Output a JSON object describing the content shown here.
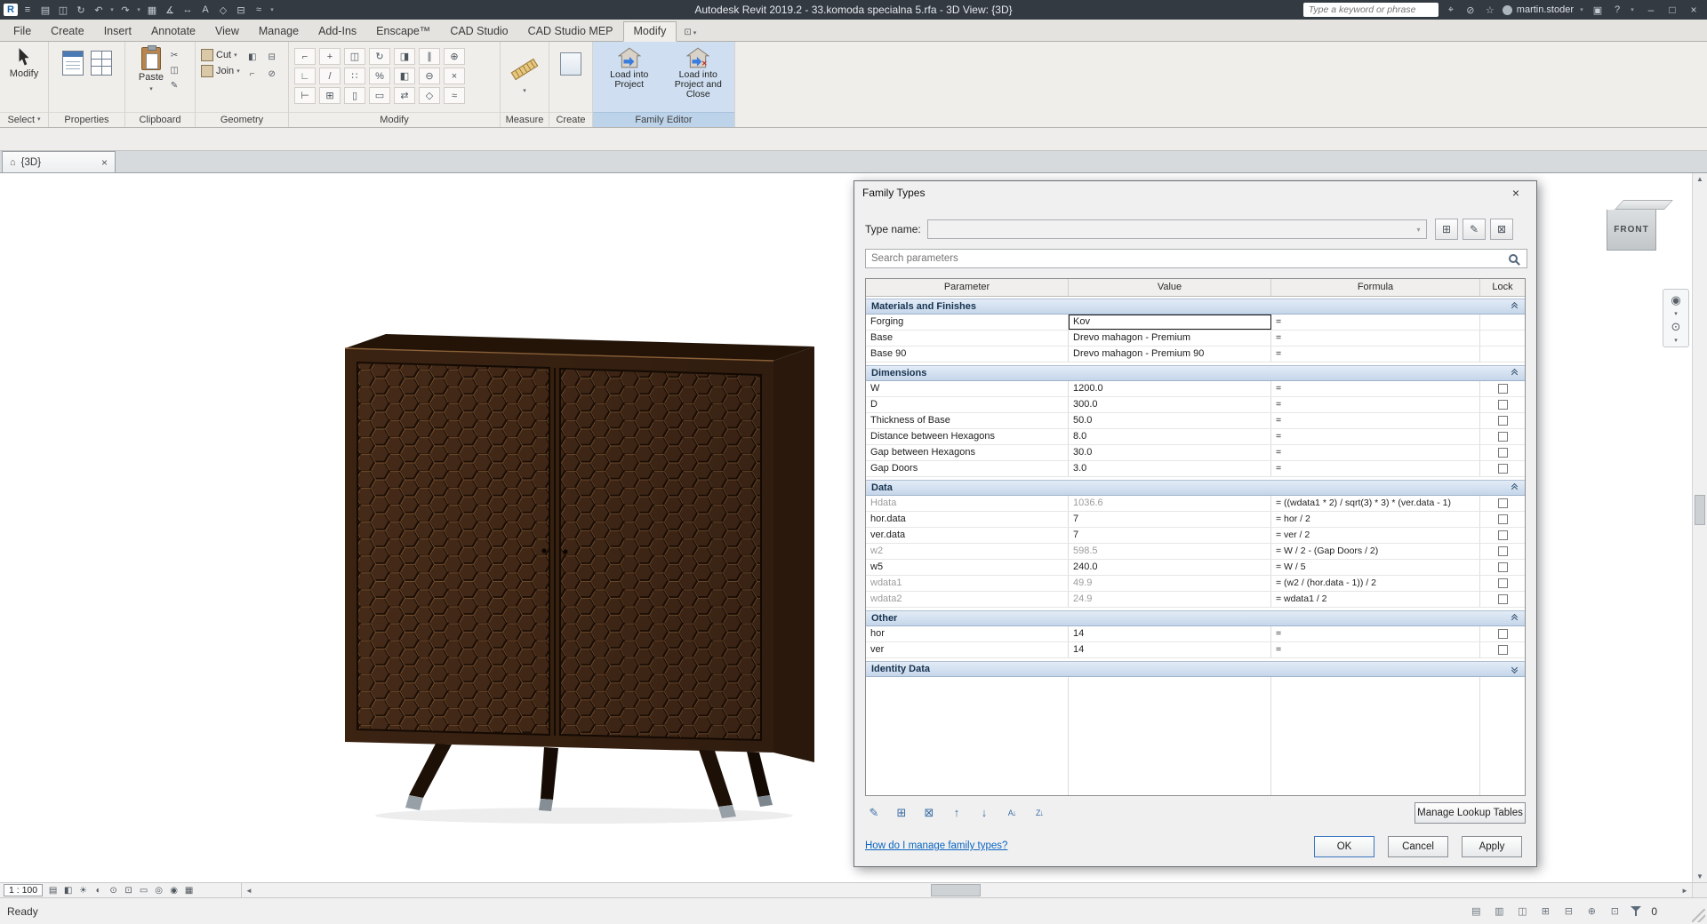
{
  "titlebar": {
    "app_title": "Autodesk Revit 2019.2 - 33.komoda specialna 5.rfa - 3D View: {3D}",
    "search_placeholder": "Type a keyword or phrase",
    "username": "martin.stoder"
  },
  "glyphs": {
    "caret": "▾",
    "close": "×",
    "house": "⌂",
    "up": "▲",
    "down": "▼",
    "left": "◄",
    "right": "►"
  },
  "ribbon": {
    "tabs": [
      {
        "label": "File",
        "active": false
      },
      {
        "label": "Create",
        "active": false
      },
      {
        "label": "Insert",
        "active": false
      },
      {
        "label": "Annotate",
        "active": false
      },
      {
        "label": "View",
        "active": false
      },
      {
        "label": "Manage",
        "active": false
      },
      {
        "label": "Add-Ins",
        "active": false
      },
      {
        "label": "Enscape™",
        "active": false
      },
      {
        "label": "CAD Studio",
        "active": false
      },
      {
        "label": "CAD Studio MEP",
        "active": false
      },
      {
        "label": "Modify",
        "active": true
      }
    ],
    "panels": {
      "select": {
        "label": "Select",
        "modify_button": "Modify"
      },
      "properties": {
        "label": "Properties"
      },
      "clipboard": {
        "label": "Clipboard",
        "paste": "Paste"
      },
      "geometry": {
        "label": "Geometry",
        "cut": "Cut",
        "join": "Join"
      },
      "modify": {
        "label": "Modify"
      },
      "measure": {
        "label": "Measure"
      },
      "create": {
        "label": "Create"
      },
      "family_editor": {
        "label": "Family Editor",
        "load": "Load into Project",
        "load_close": "Load into Project and Close"
      }
    }
  },
  "view_tabs": {
    "active": "{3D}"
  },
  "viewcube": {
    "front": "FRONT"
  },
  "dialog": {
    "title": "Family Types",
    "type_name_label": "Type name:",
    "search_placeholder": "Search parameters",
    "columns": {
      "parameter": "Parameter",
      "value": "Value",
      "formula": "Formula",
      "lock": "Lock"
    },
    "sections": [
      {
        "name": "Materials and Finishes",
        "collapsed": false,
        "rows": [
          {
            "param": "Forging",
            "value": "Kov",
            "formula": "=",
            "lockable": false,
            "gray": false,
            "focused": true
          },
          {
            "param": "Base",
            "value": "Drevo mahagon - Premium",
            "formula": "=",
            "lockable": false,
            "gray": false,
            "focused": false
          },
          {
            "param": "Base 90",
            "value": "Drevo mahagon - Premium 90",
            "formula": "=",
            "lockable": false,
            "gray": false,
            "focused": false
          }
        ]
      },
      {
        "name": "Dimensions",
        "collapsed": false,
        "rows": [
          {
            "param": "W",
            "value": "1200.0",
            "formula": "=",
            "lockable": true,
            "gray": false,
            "focused": false
          },
          {
            "param": "D",
            "value": "300.0",
            "formula": "=",
            "lockable": true,
            "gray": false,
            "focused": false
          },
          {
            "param": "Thickness of Base",
            "value": "50.0",
            "formula": "=",
            "lockable": true,
            "gray": false,
            "focused": false
          },
          {
            "param": "Distance between Hexagons",
            "value": "8.0",
            "formula": "=",
            "lockable": true,
            "gray": false,
            "focused": false
          },
          {
            "param": "Gap between Hexagons",
            "value": "30.0",
            "formula": "=",
            "lockable": true,
            "gray": false,
            "focused": false
          },
          {
            "param": "Gap Doors",
            "value": "3.0",
            "formula": "=",
            "lockable": true,
            "gray": false,
            "focused": false
          }
        ]
      },
      {
        "name": "Data",
        "collapsed": false,
        "rows": [
          {
            "param": "Hdata",
            "value": "1036.6",
            "formula": "= ((wdata1 * 2) / sqrt(3) * 3) * (ver.data - 1)",
            "lockable": true,
            "gray": true,
            "focused": false
          },
          {
            "param": "hor.data",
            "value": "7",
            "formula": "= hor / 2",
            "lockable": true,
            "gray": false,
            "focused": false
          },
          {
            "param": "ver.data",
            "value": "7",
            "formula": "= ver / 2",
            "lockable": true,
            "gray": false,
            "focused": false
          },
          {
            "param": "w2",
            "value": "598.5",
            "formula": "= W / 2 - (Gap Doors / 2)",
            "lockable": true,
            "gray": true,
            "focused": false
          },
          {
            "param": "w5",
            "value": "240.0",
            "formula": "= W / 5",
            "lockable": true,
            "gray": false,
            "focused": false
          },
          {
            "param": "wdata1",
            "value": "49.9",
            "formula": "= (w2 / (hor.data - 1)) / 2",
            "lockable": true,
            "gray": true,
            "focused": false
          },
          {
            "param": "wdata2",
            "value": "24.9",
            "formula": "= wdata1 / 2",
            "lockable": true,
            "gray": true,
            "focused": false
          }
        ]
      },
      {
        "name": "Other",
        "collapsed": false,
        "rows": [
          {
            "param": "hor",
            "value": "14",
            "formula": "=",
            "lockable": true,
            "gray": false,
            "focused": false
          },
          {
            "param": "ver",
            "value": "14",
            "formula": "=",
            "lockable": true,
            "gray": false,
            "focused": false
          }
        ]
      },
      {
        "name": "Identity Data",
        "collapsed": true,
        "rows": []
      }
    ],
    "footer": {
      "manage_lookup": "Manage Lookup Tables",
      "help_link": "How do I manage family types?",
      "ok": "OK",
      "cancel": "Cancel",
      "apply": "Apply"
    }
  },
  "status": {
    "scale": "1 : 100",
    "ready": "Ready",
    "selection_count": "0"
  },
  "colors": {
    "section_header_top": "#e3ecf7",
    "section_header_bottom": "#c5d6ea",
    "family_editor_highlight": "#cfdff1",
    "titlebar": "#333a42"
  },
  "icon_strips": {
    "qat": [
      {
        "name": "revit-logo",
        "glyph": "R",
        "cls": "logo"
      },
      {
        "name": "app-menu-icon",
        "glyph": "≡"
      },
      {
        "name": "open-icon",
        "glyph": "▤"
      },
      {
        "name": "save-icon",
        "glyph": "◫"
      },
      {
        "name": "sync-icon",
        "glyph": "↻"
      },
      {
        "name": "undo-icon",
        "glyph": "↶"
      },
      {
        "name": "undo-caret-icon",
        "glyph": "▾",
        "cls": "caret"
      },
      {
        "name": "redo-icon",
        "glyph": "↷"
      },
      {
        "name": "redo-caret-icon",
        "glyph": "▾",
        "cls": "caret"
      },
      {
        "name": "print-icon",
        "glyph": "▦"
      },
      {
        "name": "measure-qat-icon",
        "glyph": "∡"
      },
      {
        "name": "aligned-dimension-icon",
        "glyph": "↔"
      },
      {
        "name": "text-note-icon",
        "glyph": "A"
      },
      {
        "name": "default-3d-view-icon",
        "glyph": "◇"
      },
      {
        "name": "section-icon",
        "glyph": "⊟"
      },
      {
        "name": "thin-lines-icon",
        "glyph": "≈"
      },
      {
        "name": "qat-customize-caret-icon",
        "glyph": "▾",
        "cls": "caret"
      }
    ],
    "infocenter_left": [
      {
        "name": "search-go-icon",
        "glyph": "⌖"
      },
      {
        "name": "subscription-icon",
        "glyph": "⊘"
      },
      {
        "name": "favorites-icon",
        "glyph": "☆"
      }
    ],
    "infocenter_right": [
      {
        "name": "exchange-apps-icon",
        "glyph": "▣"
      },
      {
        "name": "help-icon",
        "glyph": "?"
      },
      {
        "name": "help-caret-icon",
        "glyph": "▾",
        "cls": "caret"
      }
    ],
    "window_controls": [
      {
        "name": "minimize-button",
        "glyph": "–"
      },
      {
        "name": "maximize-button",
        "glyph": "□"
      },
      {
        "name": "close-button",
        "glyph": "×"
      }
    ],
    "tab_extras": [
      {
        "name": "ribbon-state-icon",
        "glyph": "⊡"
      },
      {
        "name": "ribbon-state-caret-icon",
        "glyph": "▾",
        "cls": "caret"
      }
    ],
    "clipboard_small": [
      {
        "name": "cut-icon",
        "glyph": "✂"
      },
      {
        "name": "copy-clipboard-icon",
        "glyph": "◫"
      },
      {
        "name": "match-type-icon",
        "glyph": "✎"
      }
    ],
    "geometry_extra": [
      {
        "name": "paint-icon",
        "glyph": "◧"
      },
      {
        "name": "split-face-icon",
        "glyph": "⊟"
      },
      {
        "name": "cope-icon",
        "glyph": "⌐"
      },
      {
        "name": "demolish-icon",
        "glyph": "⊘"
      }
    ],
    "modify_grid": [
      {
        "name": "align-icon",
        "glyph": "⌐"
      },
      {
        "name": "move-icon",
        "glyph": "+"
      },
      {
        "name": "copy-icon",
        "glyph": "◫"
      },
      {
        "name": "rotate-icon",
        "glyph": "↻"
      },
      {
        "name": "mirror-axis-icon",
        "glyph": "◨"
      },
      {
        "name": "offset-icon",
        "glyph": "∥"
      },
      {
        "name": "pin-icon",
        "glyph": "⊕"
      },
      {
        "name": "trim-extend-icon",
        "glyph": "∟"
      },
      {
        "name": "split-icon",
        "glyph": "/"
      },
      {
        "name": "array-icon",
        "glyph": "∷"
      },
      {
        "name": "scale-icon",
        "glyph": "%"
      },
      {
        "name": "mirror-pick-icon",
        "glyph": "◧"
      },
      {
        "name": "unpin-icon",
        "glyph": "⊖"
      },
      {
        "name": "delete-icon",
        "glyph": "×"
      },
      {
        "name": "extend-icon",
        "glyph": "⊢"
      },
      {
        "name": "join-geometry-icon",
        "glyph": "⊞"
      },
      {
        "name": "wall-opening-icon",
        "glyph": "▯"
      },
      {
        "name": "beam-icon",
        "glyph": "▭"
      },
      {
        "name": "swap-icon",
        "glyph": "⇄"
      },
      {
        "name": "wireframe-icon",
        "glyph": "◇"
      },
      {
        "name": "more-tools-icon",
        "glyph": "≈"
      }
    ],
    "view_control": [
      {
        "name": "detail-level-icon",
        "glyph": "▤"
      },
      {
        "name": "visual-style-icon",
        "glyph": "◧"
      },
      {
        "name": "sun-path-icon",
        "glyph": "☀"
      },
      {
        "name": "shadows-icon",
        "glyph": "◐"
      },
      {
        "name": "rendering-dialog-icon",
        "glyph": "⊙"
      },
      {
        "name": "crop-view-icon",
        "glyph": "⊡"
      },
      {
        "name": "crop-region-visibility-icon",
        "glyph": "▭"
      },
      {
        "name": "temporary-hide-isolate-icon",
        "glyph": "◎"
      },
      {
        "name": "reveal-hidden-elements-icon",
        "glyph": "◉"
      },
      {
        "name": "temporary-view-properties-icon",
        "glyph": "▦"
      }
    ],
    "status_right": [
      {
        "name": "worksharing-display-icon",
        "glyph": "▤"
      },
      {
        "name": "requests-icon",
        "glyph": "▥"
      },
      {
        "name": "design-options-icon",
        "glyph": "◫"
      },
      {
        "name": "select-links-toggle-icon",
        "glyph": "⊞"
      },
      {
        "name": "select-underlay-toggle-icon",
        "glyph": "⊟"
      },
      {
        "name": "select-pinned-toggle-icon",
        "glyph": "⊕"
      },
      {
        "name": "drag-on-selection-toggle-icon",
        "glyph": "⊡"
      }
    ],
    "dlg_tools": [
      {
        "name": "edit-parameter-button",
        "glyph": "✎"
      },
      {
        "name": "new-parameter-button",
        "glyph": "⊞"
      },
      {
        "name": "delete-parameter-button",
        "glyph": "⊠"
      },
      {
        "name": "move-parameter-up-button",
        "glyph": "↑"
      },
      {
        "name": "move-parameter-down-button",
        "glyph": "↓"
      },
      {
        "name": "sort-ascending-button",
        "glyph": "A↓",
        "cls": "sm"
      },
      {
        "name": "sort-descending-button",
        "glyph": "Z↓",
        "cls": "sm"
      }
    ],
    "type_buttons": [
      {
        "name": "new-type-button",
        "glyph": "⊞"
      },
      {
        "name": "rename-type-button",
        "glyph": "✎"
      },
      {
        "name": "delete-type-button",
        "glyph": "⊠"
      }
    ],
    "navbar": [
      {
        "name": "steering-wheel-icon",
        "glyph": "◉"
      },
      {
        "name": "nav-wheel-caret-icon",
        "glyph": "▾",
        "cls": "caret"
      },
      {
        "name": "zoom-icon",
        "glyph": "⊙"
      },
      {
        "name": "zoom-caret-icon",
        "glyph": "▾",
        "cls": "caret"
      }
    ]
  }
}
